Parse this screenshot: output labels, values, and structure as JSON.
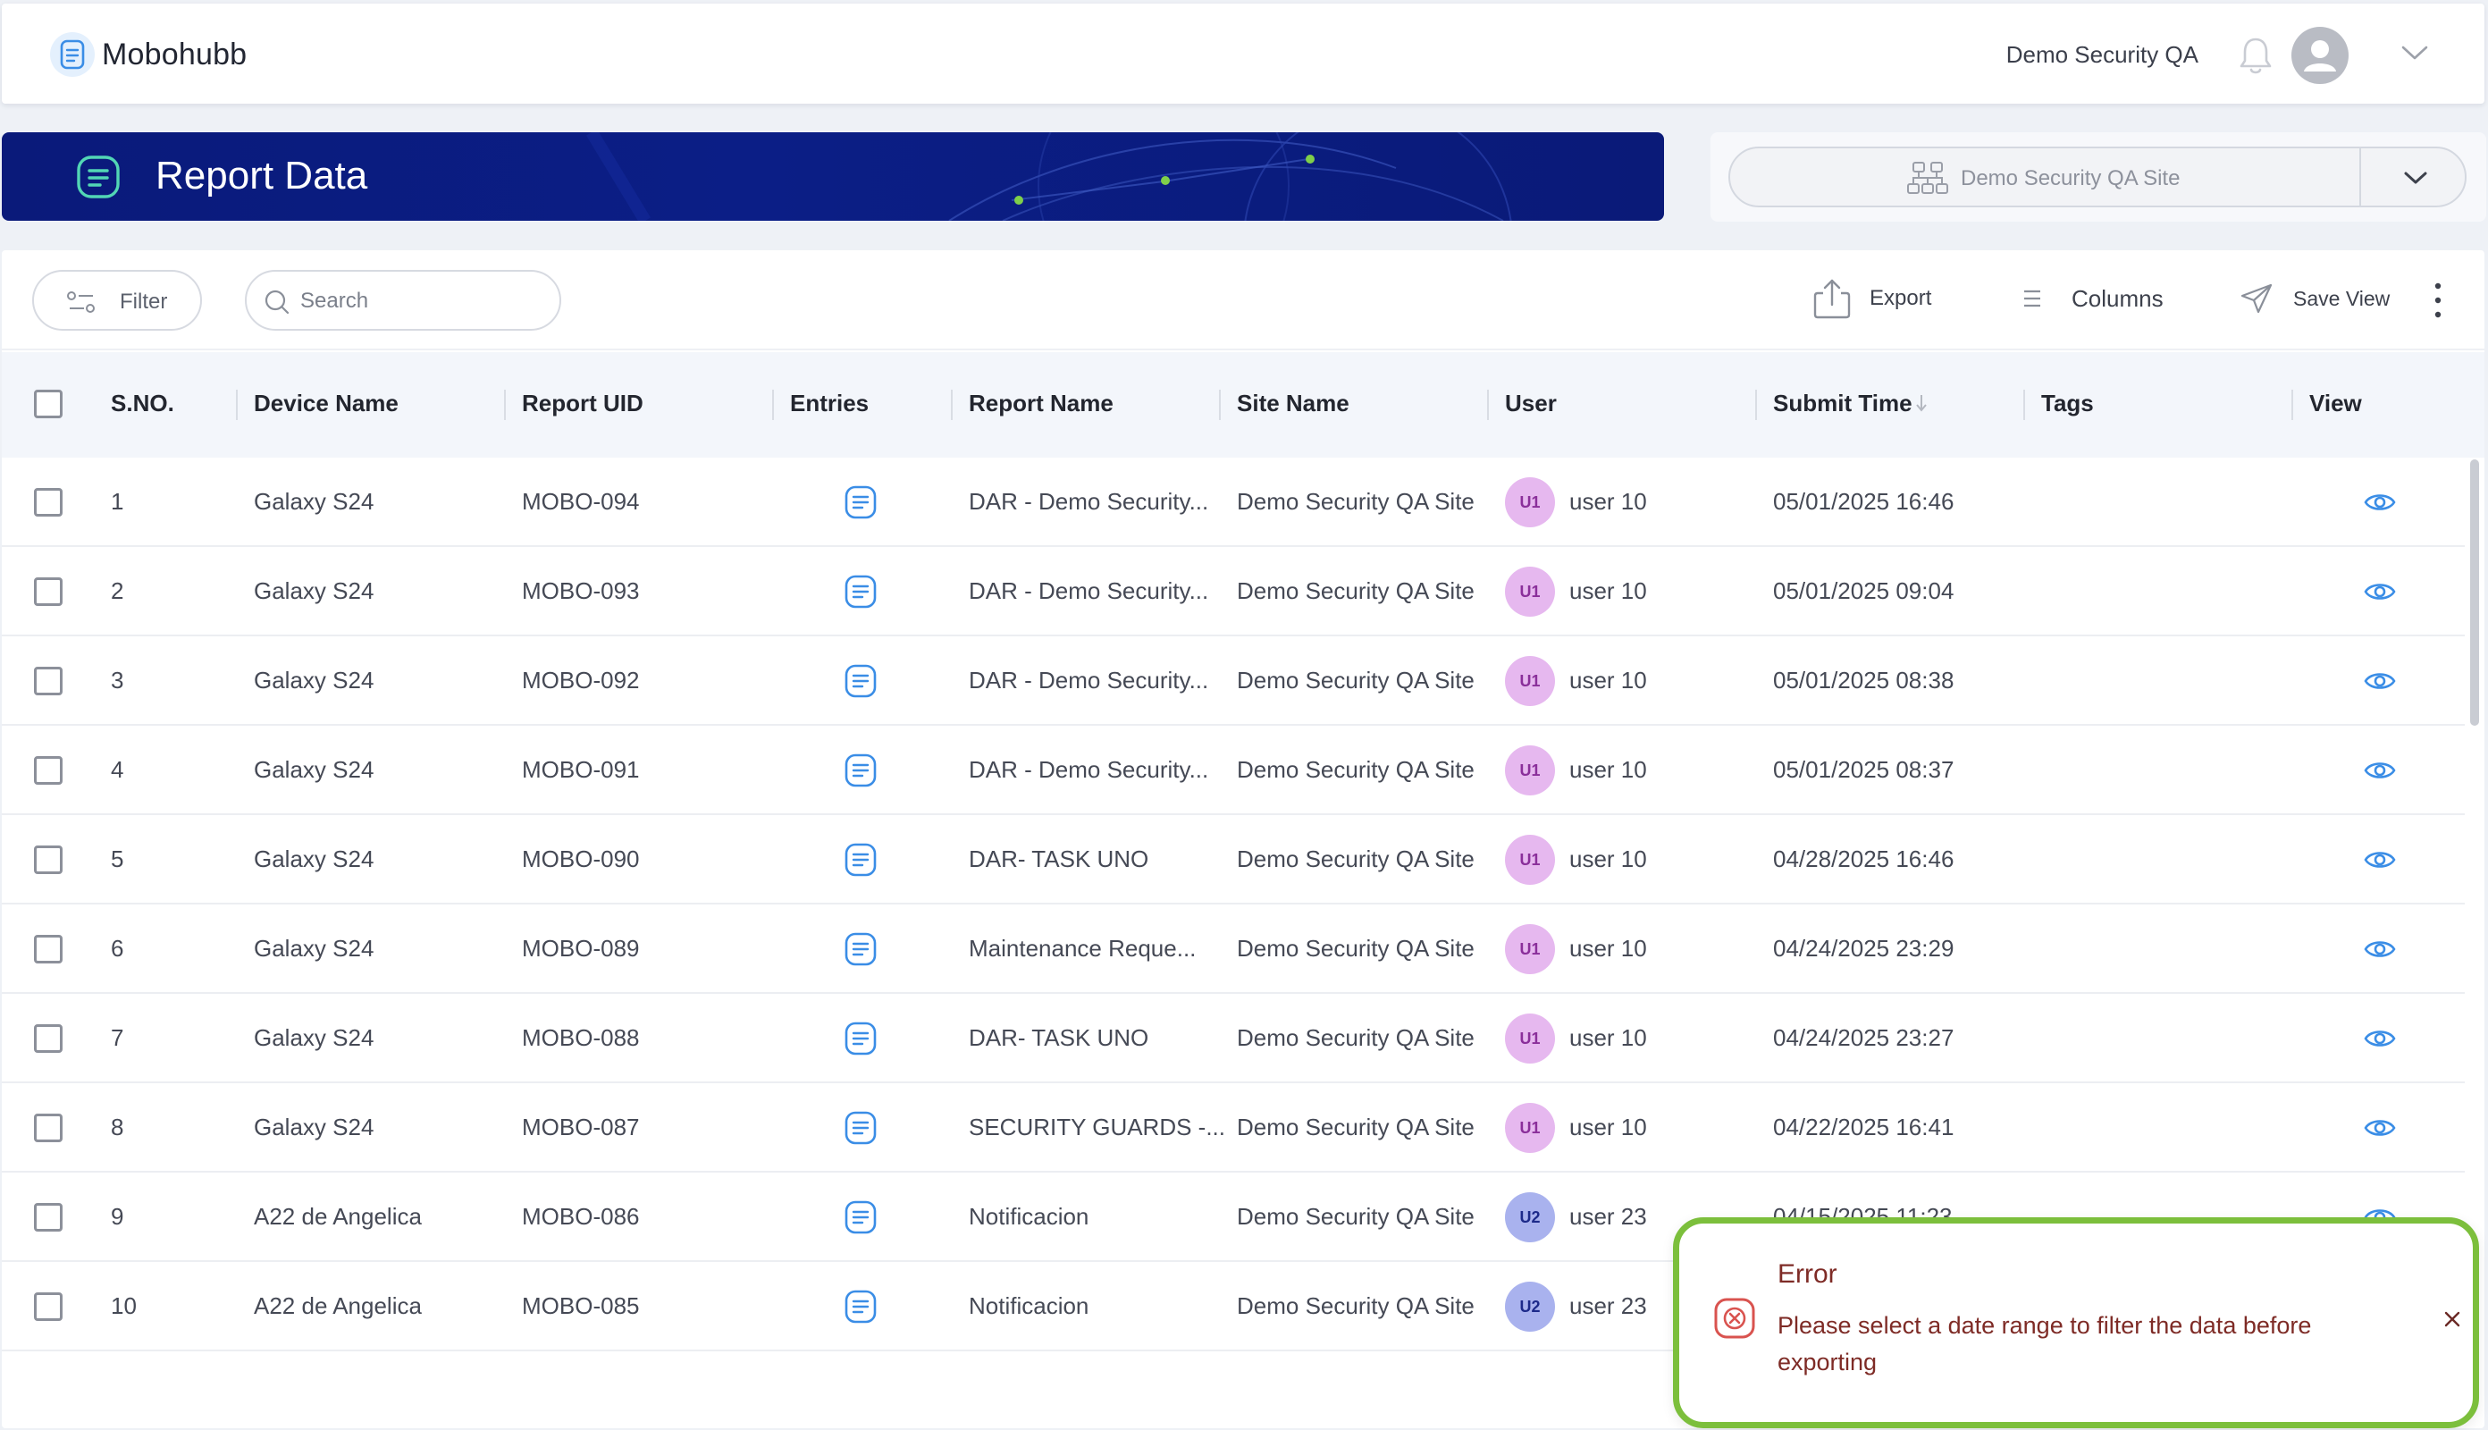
{
  "header": {
    "brand": "Mobohubb",
    "org_name": "Demo Security QA",
    "icons": [
      "document-icon",
      "bell-icon",
      "avatar-icon",
      "chevron-down-icon"
    ]
  },
  "banner": {
    "title": "Report Data",
    "colors": {
      "background": "#0b1e86",
      "accent_dot": "#7fcf4a"
    }
  },
  "site_selector": {
    "value": "Demo Security QA Site"
  },
  "toolbar": {
    "filter_label": "Filter",
    "search_placeholder": "Search",
    "export_label": "Export",
    "columns_label": "Columns",
    "save_view_label": "Save View"
  },
  "table": {
    "columns": {
      "sno": "S.NO.",
      "device": "Device Name",
      "uid": "Report UID",
      "entries": "Entries",
      "report": "Report Name",
      "site": "Site Name",
      "user": "User",
      "submit": "Submit Time",
      "tags": "Tags",
      "view": "View"
    },
    "sort": {
      "column": "Submit Time",
      "direction": "descending"
    },
    "rows": [
      {
        "sno": "1",
        "device": "Galaxy S24",
        "uid": "MOBO-094",
        "report": "DAR - Demo Security...",
        "site": "Demo Security QA Site",
        "badge": "U1",
        "user": "user 10",
        "submit": "05/01/2025 16:46",
        "tags": ""
      },
      {
        "sno": "2",
        "device": "Galaxy S24",
        "uid": "MOBO-093",
        "report": "DAR - Demo Security...",
        "site": "Demo Security QA Site",
        "badge": "U1",
        "user": "user 10",
        "submit": "05/01/2025 09:04",
        "tags": ""
      },
      {
        "sno": "3",
        "device": "Galaxy S24",
        "uid": "MOBO-092",
        "report": "DAR - Demo Security...",
        "site": "Demo Security QA Site",
        "badge": "U1",
        "user": "user 10",
        "submit": "05/01/2025 08:38",
        "tags": ""
      },
      {
        "sno": "4",
        "device": "Galaxy S24",
        "uid": "MOBO-091",
        "report": "DAR - Demo Security...",
        "site": "Demo Security QA Site",
        "badge": "U1",
        "user": "user 10",
        "submit": "05/01/2025 08:37",
        "tags": ""
      },
      {
        "sno": "5",
        "device": "Galaxy S24",
        "uid": "MOBO-090",
        "report": "DAR- TASK UNO",
        "site": "Demo Security QA Site",
        "badge": "U1",
        "user": "user 10",
        "submit": "04/28/2025 16:46",
        "tags": ""
      },
      {
        "sno": "6",
        "device": "Galaxy S24",
        "uid": "MOBO-089",
        "report": "Maintenance Reque...",
        "site": "Demo Security QA Site",
        "badge": "U1",
        "user": "user 10",
        "submit": "04/24/2025 23:29",
        "tags": ""
      },
      {
        "sno": "7",
        "device": "Galaxy S24",
        "uid": "MOBO-088",
        "report": "DAR- TASK UNO",
        "site": "Demo Security QA Site",
        "badge": "U1",
        "user": "user 10",
        "submit": "04/24/2025 23:27",
        "tags": ""
      },
      {
        "sno": "8",
        "device": "Galaxy S24",
        "uid": "MOBO-087",
        "report": "SECURITY GUARDS -...",
        "site": "Demo Security QA Site",
        "badge": "U1",
        "user": "user 10",
        "submit": "04/22/2025 16:41",
        "tags": ""
      },
      {
        "sno": "9",
        "device": "A22 de Angelica",
        "uid": "MOBO-086",
        "report": "Notificacion",
        "site": "Demo Security QA Site",
        "badge": "U2",
        "user": "user 23",
        "submit": "04/15/2025 11:23",
        "tags": ""
      },
      {
        "sno": "10",
        "device": "A22 de Angelica",
        "uid": "MOBO-085",
        "report": "Notificacion",
        "site": "Demo Security QA Site",
        "badge": "U2",
        "user": "user 23",
        "submit": "",
        "tags": ""
      }
    ],
    "badge_colors": {
      "U1": "#e6b8ef",
      "U2": "#a9b2ee"
    }
  },
  "toast": {
    "title": "Error",
    "message": "Please select a date range to filter the data before exporting",
    "colors": {
      "border": "#7cbf3c",
      "text": "#7e2b26",
      "icon": "#d9534f"
    }
  }
}
